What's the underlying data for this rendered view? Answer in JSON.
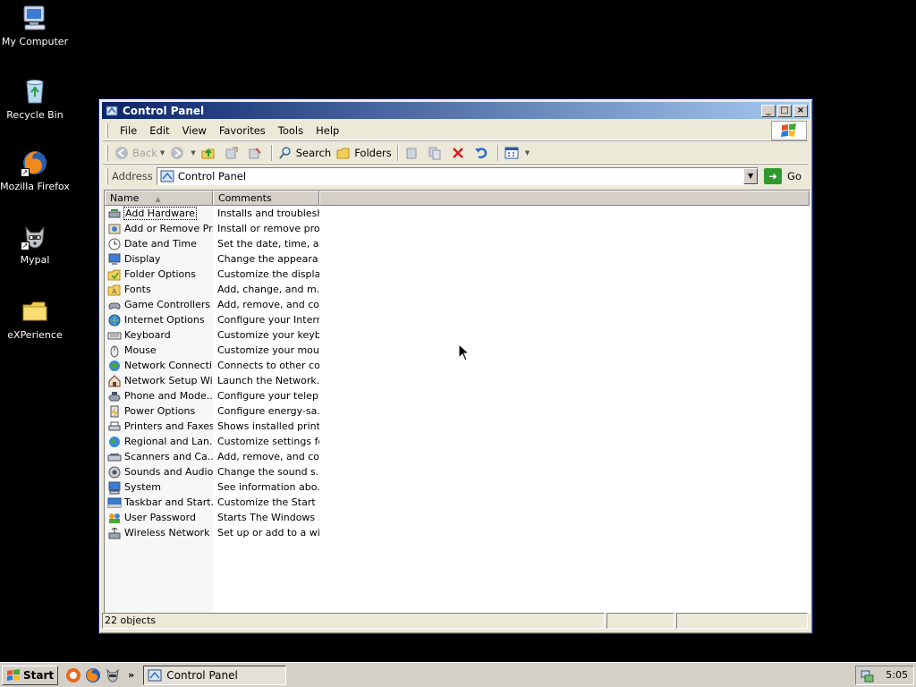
{
  "desktop": {
    "icons": [
      {
        "label": "My Computer",
        "icon": "my-computer-icon"
      },
      {
        "label": "Recycle Bin",
        "icon": "recycle-bin-icon"
      },
      {
        "label": "Mozilla Firefox",
        "icon": "firefox-icon"
      },
      {
        "label": "Mypal",
        "icon": "mypal-icon"
      },
      {
        "label": "eXPerience",
        "icon": "folder-icon"
      }
    ]
  },
  "window": {
    "title": "Control Panel",
    "menu": [
      "File",
      "Edit",
      "View",
      "Favorites",
      "Tools",
      "Help"
    ],
    "toolbar": {
      "back": "Back",
      "search": "Search",
      "folders": "Folders"
    },
    "address": {
      "label": "Address",
      "value": "Control Panel",
      "go": "Go"
    },
    "columns": {
      "name": "Name",
      "comments": "Comments"
    },
    "items": [
      {
        "name": "Add Hardware",
        "comment": "Installs and troublesh...",
        "icon": "add-hardware-icon"
      },
      {
        "name": "Add or Remove Pr...",
        "comment": "Install or remove pro...",
        "icon": "add-remove-programs-icon"
      },
      {
        "name": "Date and Time",
        "comment": "Set the date, time, a...",
        "icon": "date-time-icon"
      },
      {
        "name": "Display",
        "comment": "Change the appeara...",
        "icon": "display-icon"
      },
      {
        "name": "Folder Options",
        "comment": "Customize the displa...",
        "icon": "folder-options-icon"
      },
      {
        "name": "Fonts",
        "comment": "Add, change, and m...",
        "icon": "fonts-icon"
      },
      {
        "name": "Game Controllers",
        "comment": "Add, remove, and co...",
        "icon": "game-controllers-icon"
      },
      {
        "name": "Internet Options",
        "comment": "Configure your Intern...",
        "icon": "internet-options-icon"
      },
      {
        "name": "Keyboard",
        "comment": "Customize your keyb...",
        "icon": "keyboard-icon"
      },
      {
        "name": "Mouse",
        "comment": "Customize your mous...",
        "icon": "mouse-icon"
      },
      {
        "name": "Network Connecti...",
        "comment": "Connects to other co...",
        "icon": "network-connections-icon"
      },
      {
        "name": "Network Setup Wi...",
        "comment": "Launch the Network...",
        "icon": "network-setup-icon"
      },
      {
        "name": "Phone and Mode...",
        "comment": "Configure your telep...",
        "icon": "phone-modem-icon"
      },
      {
        "name": "Power Options",
        "comment": "Configure energy-sa...",
        "icon": "power-options-icon"
      },
      {
        "name": "Printers and Faxes",
        "comment": "Shows installed print...",
        "icon": "printers-faxes-icon"
      },
      {
        "name": "Regional and Lan...",
        "comment": "Customize settings fo...",
        "icon": "regional-language-icon"
      },
      {
        "name": "Scanners and Ca...",
        "comment": "Add, remove, and co...",
        "icon": "scanners-cameras-icon"
      },
      {
        "name": "Sounds and Audio...",
        "comment": "Change the sound s...",
        "icon": "sounds-audio-icon"
      },
      {
        "name": "System",
        "comment": "See information abo...",
        "icon": "system-icon"
      },
      {
        "name": "Taskbar and Start...",
        "comment": "Customize the Start ...",
        "icon": "taskbar-start-icon"
      },
      {
        "name": "User Password",
        "comment": "Starts The Windows ...",
        "icon": "user-password-icon"
      },
      {
        "name": "Wireless Network ...",
        "comment": "Set up or add to a wi...",
        "icon": "wireless-network-icon"
      }
    ],
    "status": "22 objects"
  },
  "taskbar": {
    "start": "Start",
    "task": "Control Panel",
    "clock": "5:05",
    "more": "»"
  },
  "colors": {
    "title_active": "#0a246a",
    "title_gradient_end": "#a6caf0",
    "chrome": "#ece9d8",
    "taskbar": "#d4d0c8"
  }
}
